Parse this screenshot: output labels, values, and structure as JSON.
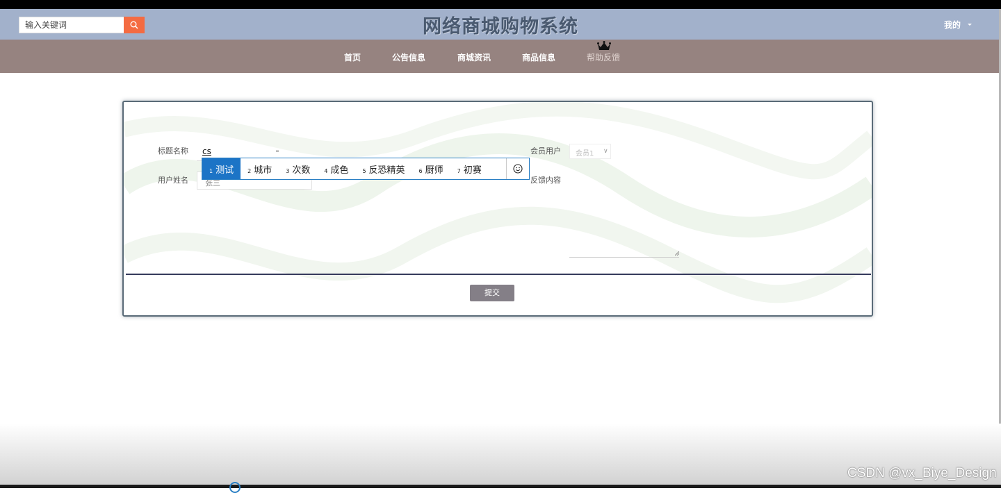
{
  "header": {
    "search_placeholder": "输入关键词",
    "site_title": "网络商城购物系统",
    "user_menu": "我的"
  },
  "nav": {
    "items": [
      {
        "label": "首页"
      },
      {
        "label": "公告信息"
      },
      {
        "label": "商城资讯"
      },
      {
        "label": "商品信息"
      },
      {
        "label": "帮助反馈"
      }
    ],
    "active_index": 4
  },
  "form": {
    "labels": {
      "title": "标题名称",
      "user_name": "用户姓名",
      "member_user": "会员用户",
      "content": "反馈内容"
    },
    "values": {
      "title_composing": "cs",
      "user_name": "张三",
      "member_user": "会员1"
    },
    "submit_label": "提交"
  },
  "ime": {
    "candidates": [
      {
        "num": "1",
        "text": "测试"
      },
      {
        "num": "2",
        "text": "城市"
      },
      {
        "num": "3",
        "text": "次数"
      },
      {
        "num": "4",
        "text": "成色"
      },
      {
        "num": "5",
        "text": "反恐精英"
      },
      {
        "num": "6",
        "text": "厨师"
      },
      {
        "num": "7",
        "text": "初赛"
      }
    ],
    "selected_index": 0,
    "emoji_icon": "smiley-icon"
  },
  "watermark": "CSDN @vx_Biye_Design",
  "colors": {
    "header_bg": "#a2b1cb",
    "nav_bg": "#968380",
    "search_button": "#f46b42",
    "ime_selected": "#1c74c6",
    "divider": "#363a5c",
    "submit_bg": "#847f87"
  }
}
